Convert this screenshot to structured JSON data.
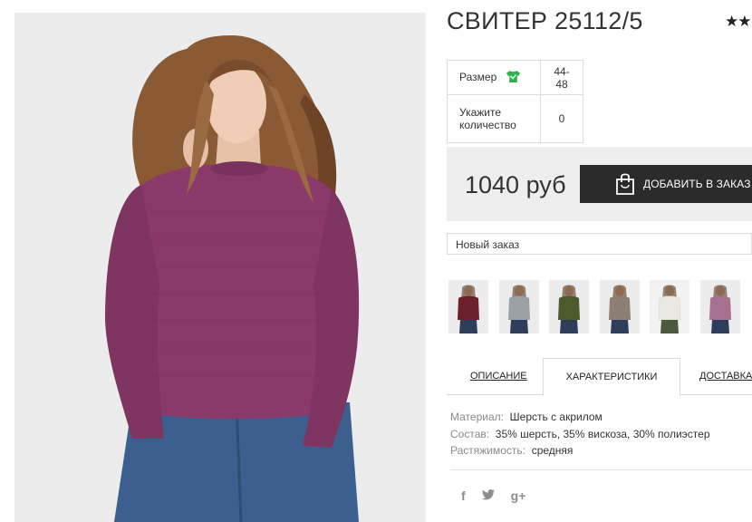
{
  "product": {
    "title": "СВИТЕР 25112/5",
    "rating_display": "★★"
  },
  "options": [
    {
      "label": "Размер",
      "value": "44-48",
      "icon": "tshirt-icon"
    },
    {
      "label": "Укажите количество",
      "value": "0"
    }
  ],
  "price": {
    "value": "1040 руб",
    "button_label": "ДОБАВИТЬ В ЗАКАЗ"
  },
  "order_select": {
    "value": "Новый заказ"
  },
  "variants": [
    {
      "color": "#6e1f2c"
    },
    {
      "color": "#9aa0a6"
    },
    {
      "color": "#4d5a2c"
    },
    {
      "color": "#8c8073"
    },
    {
      "color": "#e9e8e1"
    },
    {
      "color": "#a8708f"
    }
  ],
  "tabs": [
    "ОПИСАНИЕ",
    "ХАРАКТЕРИСТИКИ",
    "ДОСТАВКА"
  ],
  "specs": [
    {
      "key": "Материал:",
      "value": "Шерсть с акрилом"
    },
    {
      "key": "Состав:",
      "value": "35% шерсть, 35% вискоза, 30% полиэстер"
    },
    {
      "key": "Растяжимость:",
      "value": "средняя"
    }
  ],
  "social": [
    "f",
    "🐦",
    "g+"
  ],
  "colors": {
    "accent_dark": "#2b2b2b",
    "panel_gray": "#eeeeee",
    "size_icon_green": "#2db34a",
    "sweater": "#8a3a6a"
  }
}
